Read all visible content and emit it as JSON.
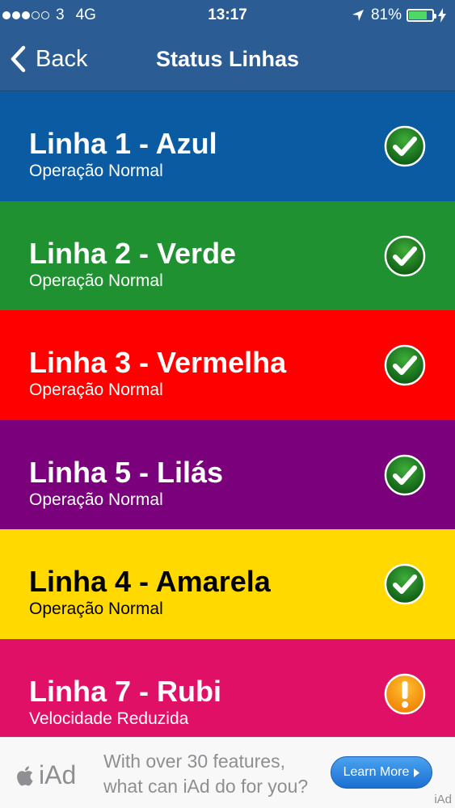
{
  "status_bar": {
    "carrier": "3",
    "network": "4G",
    "time": "13:17",
    "battery_percent": "81%",
    "signal_filled": 3,
    "signal_total": 5,
    "battery_level": 0.81
  },
  "nav": {
    "back_label": "Back",
    "title": "Status Linhas"
  },
  "lines": [
    {
      "name": "Linha 1 - Azul",
      "status": "Operação Normal",
      "color": "#0b5ba3",
      "text_color": "#ffffff",
      "icon": "check-icon"
    },
    {
      "name": "Linha 2 - Verde",
      "status": "Operação Normal",
      "color": "#1f9131",
      "text_color": "#ffffff",
      "icon": "check-icon"
    },
    {
      "name": "Linha 3 - Vermelha",
      "status": "Operação Normal",
      "color": "#ff0000",
      "text_color": "#ffffff",
      "icon": "check-icon"
    },
    {
      "name": "Linha 5 - Lilás",
      "status": "Operação Normal",
      "color": "#7b007b",
      "text_color": "#ffffff",
      "icon": "check-icon"
    },
    {
      "name": "Linha 4 - Amarela",
      "status": "Operação Normal",
      "color": "#ffd900",
      "text_color": "#000000",
      "icon": "check-icon"
    },
    {
      "name": "Linha 7 - Rubi",
      "status": "Velocidade Reduzida",
      "color": "#e01066",
      "text_color": "#ffffff",
      "icon": "warning-icon"
    }
  ],
  "ad": {
    "logo_text": "iAd",
    "message_line1": "With over 30 features,",
    "message_line2": "what can iAd do for you?",
    "button_label": "Learn More",
    "corner_label": "iAd"
  }
}
